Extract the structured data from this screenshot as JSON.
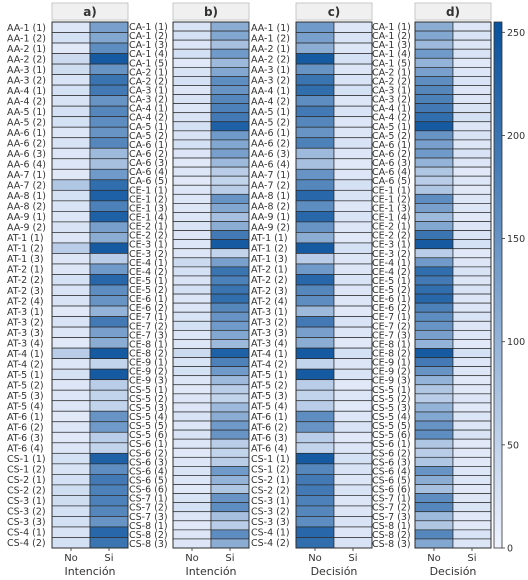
{
  "chart_data": {
    "type": "heatmap",
    "colorbar": {
      "ticks": [
        "0",
        "50",
        "100",
        "150",
        "200",
        "250"
      ],
      "tick_values": [
        0,
        50,
        100,
        150,
        200,
        250
      ],
      "range": [
        0,
        255
      ],
      "colors": [
        "#eff3ff",
        "#08519c"
      ]
    },
    "panels": [
      {
        "title": "a)",
        "xlabel": "Intención",
        "columns": [
          "No",
          "Si"
        ],
        "rows": [
          "AA-1 (1)",
          "AA-1 (2)",
          "AA-2 (1)",
          "AA-2 (2)",
          "AA-3 (1)",
          "AA-3 (2)",
          "AA-4 (1)",
          "AA-4 (2)",
          "AA-5 (1)",
          "AA-5 (2)",
          "AA-6 (1)",
          "AA-6 (2)",
          "AA-6 (3)",
          "AA-6 (4)",
          "AA-7 (1)",
          "AA-7 (2)",
          "AA-8 (1)",
          "AA-8 (2)",
          "AA-9 (1)",
          "AA-9 (2)",
          "AT-1 (1)",
          "AT-1 (2)",
          "AT-1 (3)",
          "AT-2 (1)",
          "AT-2 (2)",
          "AT-2 (3)",
          "AT-2 (4)",
          "AT-3 (1)",
          "AT-3 (2)",
          "AT-3 (3)",
          "AT-3 (4)",
          "AT-4 (1)",
          "AT-4 (2)",
          "AT-5 (1)",
          "AT-5 (2)",
          "AT-5 (3)",
          "AT-5 (4)",
          "AT-6 (1)",
          "AT-6 (2)",
          "AT-6 (3)",
          "AT-6 (4)",
          "CS-1 (1)",
          "CS-1 (2)",
          "CS-2 (1)",
          "CS-2 (2)",
          "CS-3 (1)",
          "CS-3 (2)",
          "CS-3 (3)",
          "CS-4 (1)",
          "CS-4 (2)"
        ],
        "values": [
          [
            20,
            130
          ],
          [
            30,
            120
          ],
          [
            15,
            160
          ],
          [
            40,
            240
          ],
          [
            35,
            150
          ],
          [
            25,
            200
          ],
          [
            30,
            190
          ],
          [
            25,
            150
          ],
          [
            30,
            170
          ],
          [
            30,
            160
          ],
          [
            20,
            150
          ],
          [
            25,
            170
          ],
          [
            20,
            90
          ],
          [
            20,
            80
          ],
          [
            15,
            140
          ],
          [
            70,
            210
          ],
          [
            30,
            230
          ],
          [
            25,
            180
          ],
          [
            20,
            230
          ],
          [
            25,
            130
          ],
          [
            20,
            110
          ],
          [
            60,
            240
          ],
          [
            20,
            60
          ],
          [
            20,
            140
          ],
          [
            30,
            220
          ],
          [
            25,
            160
          ],
          [
            25,
            150
          ],
          [
            15,
            100
          ],
          [
            25,
            190
          ],
          [
            20,
            130
          ],
          [
            15,
            110
          ],
          [
            60,
            240
          ],
          [
            20,
            50
          ],
          [
            30,
            240
          ],
          [
            20,
            60
          ],
          [
            20,
            50
          ],
          [
            20,
            50
          ],
          [
            15,
            150
          ],
          [
            20,
            140
          ],
          [
            15,
            60
          ],
          [
            20,
            50
          ],
          [
            30,
            230
          ],
          [
            25,
            160
          ],
          [
            30,
            190
          ],
          [
            35,
            180
          ],
          [
            35,
            180
          ],
          [
            30,
            170
          ],
          [
            30,
            150
          ],
          [
            25,
            220
          ],
          [
            30,
            200
          ]
        ]
      },
      {
        "title": "b)",
        "xlabel": "Intención",
        "columns": [
          "No",
          "Si"
        ],
        "rows": [
          "CA-1 (1)",
          "CA-1 (2)",
          "CA-1 (3)",
          "CA-1 (4)",
          "CA-1 (5)",
          "CA-2 (1)",
          "CA-2 (2)",
          "CA-3 (1)",
          "CA-3 (2)",
          "CA-4 (1)",
          "CA-4 (2)",
          "CA-5 (1)",
          "CA-5 (2)",
          "CA-6 (1)",
          "CA-6 (2)",
          "CA-6 (3)",
          "CA-6 (4)",
          "CA-6 (5)",
          "CE-1 (1)",
          "CE-1 (2)",
          "CE-1 (3)",
          "CE-1 (4)",
          "CE-2 (1)",
          "CE-2 (2)",
          "CE-3 (1)",
          "CE-3 (2)",
          "CE-4 (1)",
          "CE-4 (2)",
          "CE-5 (1)",
          "CE-5 (2)",
          "CE-6 (1)",
          "CE-6 (2)",
          "CE-7 (1)",
          "CE-7 (2)",
          "CE-7 (3)",
          "CE-8 (1)",
          "CE-8 (2)",
          "CE-9 (1)",
          "CE-9 (2)",
          "CE-9 (3)",
          "CS-5 (1)",
          "CS-5 (2)",
          "CS-5 (3)",
          "CS-5 (4)",
          "CS-5 (5)",
          "CS-5 (6)",
          "CS-6 (1)",
          "CS-6 (2)",
          "CS-6 (3)",
          "CS-6 (4)",
          "CS-6 (5)",
          "CS-6 (6)",
          "CS-7 (1)",
          "CS-7 (2)",
          "CS-7 (3)",
          "CS-8 (1)",
          "CS-8 (2)",
          "CS-8 (3)"
        ],
        "values": [
          [
            25,
            110
          ],
          [
            30,
            120
          ],
          [
            20,
            80
          ],
          [
            30,
            140
          ],
          [
            15,
            90
          ],
          [
            25,
            120
          ],
          [
            30,
            160
          ],
          [
            20,
            150
          ],
          [
            25,
            170
          ],
          [
            20,
            180
          ],
          [
            25,
            190
          ],
          [
            30,
            230
          ],
          [
            25,
            140
          ],
          [
            30,
            120
          ],
          [
            20,
            130
          ],
          [
            15,
            90
          ],
          [
            20,
            60
          ],
          [
            15,
            50
          ],
          [
            20,
            60
          ],
          [
            20,
            150
          ],
          [
            20,
            120
          ],
          [
            20,
            80
          ],
          [
            25,
            110
          ],
          [
            20,
            190
          ],
          [
            20,
            240
          ],
          [
            20,
            50
          ],
          [
            40,
            130
          ],
          [
            30,
            200
          ],
          [
            25,
            180
          ],
          [
            30,
            200
          ],
          [
            20,
            210
          ],
          [
            20,
            170
          ],
          [
            25,
            150
          ],
          [
            30,
            140
          ],
          [
            20,
            120
          ],
          [
            20,
            90
          ],
          [
            40,
            230
          ],
          [
            25,
            180
          ],
          [
            30,
            140
          ],
          [
            20,
            90
          ],
          [
            15,
            60
          ],
          [
            20,
            50
          ],
          [
            20,
            90
          ],
          [
            25,
            110
          ],
          [
            20,
            140
          ],
          [
            25,
            150
          ],
          [
            20,
            60
          ],
          [
            15,
            50
          ],
          [
            20,
            60
          ],
          [
            25,
            140
          ],
          [
            20,
            100
          ],
          [
            15,
            70
          ],
          [
            25,
            150
          ],
          [
            30,
            160
          ],
          [
            20,
            80
          ],
          [
            15,
            60
          ],
          [
            20,
            160
          ],
          [
            20,
            110
          ]
        ]
      },
      {
        "title": "c)",
        "xlabel": "Decisión",
        "columns": [
          "No",
          "Si"
        ],
        "rows": [
          "AA-1 (1)",
          "AA-1 (2)",
          "AA-2 (1)",
          "AA-2 (2)",
          "AA-3 (1)",
          "AA-3 (2)",
          "AA-4 (1)",
          "AA-4 (2)",
          "AA-5 (1)",
          "AA-5 (2)",
          "AA-6 (1)",
          "AA-6 (2)",
          "AA-6 (3)",
          "AA-6 (4)",
          "AA-7 (1)",
          "AA-7 (2)",
          "AA-8 (1)",
          "AA-8 (2)",
          "AA-9 (1)",
          "AA-9 (2)",
          "AT-1 (1)",
          "AT-1 (2)",
          "AT-1 (3)",
          "AT-2 (1)",
          "AT-2 (2)",
          "AT-2 (3)",
          "AT-2 (4)",
          "AT-3 (1)",
          "AT-3 (2)",
          "AT-3 (3)",
          "AT-3 (4)",
          "AT-4 (1)",
          "AT-4 (2)",
          "AT-5 (1)",
          "AT-5 (2)",
          "AT-5 (3)",
          "AT-5 (4)",
          "AT-6 (1)",
          "AT-6 (2)",
          "AT-6 (3)",
          "AT-6 (4)",
          "CS-1 (1)",
          "CS-1 (2)",
          "CS-2 (1)",
          "CS-2 (2)",
          "CS-3 (1)",
          "CS-3 (2)",
          "CS-3 (3)",
          "CS-4 (1)",
          "CS-4 (2)"
        ],
        "values": [
          [
            140,
            20
          ],
          [
            130,
            25
          ],
          [
            110,
            20
          ],
          [
            240,
            30
          ],
          [
            150,
            20
          ],
          [
            200,
            25
          ],
          [
            210,
            30
          ],
          [
            160,
            20
          ],
          [
            190,
            25
          ],
          [
            170,
            20
          ],
          [
            150,
            20
          ],
          [
            180,
            25
          ],
          [
            90,
            20
          ],
          [
            80,
            15
          ],
          [
            150,
            20
          ],
          [
            170,
            30
          ],
          [
            220,
            25
          ],
          [
            160,
            20
          ],
          [
            220,
            25
          ],
          [
            150,
            20
          ],
          [
            110,
            15
          ],
          [
            240,
            30
          ],
          [
            60,
            20
          ],
          [
            140,
            20
          ],
          [
            220,
            25
          ],
          [
            170,
            20
          ],
          [
            160,
            20
          ],
          [
            90,
            15
          ],
          [
            190,
            25
          ],
          [
            130,
            20
          ],
          [
            110,
            15
          ],
          [
            240,
            30
          ],
          [
            50,
            20
          ],
          [
            240,
            25
          ],
          [
            60,
            15
          ],
          [
            50,
            20
          ],
          [
            60,
            15
          ],
          [
            160,
            20
          ],
          [
            150,
            25
          ],
          [
            60,
            15
          ],
          [
            50,
            20
          ],
          [
            240,
            30
          ],
          [
            170,
            25
          ],
          [
            190,
            20
          ],
          [
            190,
            25
          ],
          [
            180,
            20
          ],
          [
            170,
            20
          ],
          [
            160,
            25
          ],
          [
            220,
            20
          ],
          [
            210,
            25
          ]
        ]
      },
      {
        "title": "d)",
        "xlabel": "Decisión",
        "columns": [
          "No",
          "Si"
        ],
        "rows": [
          "CA-1 (1)",
          "CA-1 (2)",
          "CA-1 (3)",
          "CA-1 (4)",
          "CA-1 (5)",
          "CA-2 (1)",
          "CA-2 (2)",
          "CA-3 (1)",
          "CA-3 (2)",
          "CA-4 (1)",
          "CA-4 (2)",
          "CA-5 (1)",
          "CA-5 (2)",
          "CA-6 (1)",
          "CA-6 (2)",
          "CA-6 (3)",
          "CA-6 (4)",
          "CA-6 (5)",
          "CE-1 (1)",
          "CE-1 (2)",
          "CE-1 (3)",
          "CE-1 (4)",
          "CE-2 (1)",
          "CE-2 (2)",
          "CE-3 (1)",
          "CE-3 (2)",
          "CE-4 (1)",
          "CE-4 (2)",
          "CE-5 (1)",
          "CE-5 (2)",
          "CE-6 (1)",
          "CE-6 (2)",
          "CE-7 (1)",
          "CE-7 (2)",
          "CE-7 (3)",
          "CE-8 (1)",
          "CE-8 (2)",
          "CE-9 (1)",
          "CE-9 (2)",
          "CE-9 (3)",
          "CS-5 (1)",
          "CS-5 (2)",
          "CS-5 (3)",
          "CS-5 (4)",
          "CS-5 (5)",
          "CS-5 (6)",
          "CS-6 (1)",
          "CS-6 (2)",
          "CS-6 (3)",
          "CS-6 (4)",
          "CS-6 (5)",
          "CS-6 (6)",
          "CS-7 (1)",
          "CS-7 (2)",
          "CS-7 (3)",
          "CS-8 (1)",
          "CS-8 (2)",
          "CS-8 (3)"
        ],
        "values": [
          [
            110,
            20
          ],
          [
            120,
            25
          ],
          [
            90,
            20
          ],
          [
            140,
            25
          ],
          [
            100,
            15
          ],
          [
            130,
            20
          ],
          [
            160,
            25
          ],
          [
            170,
            20
          ],
          [
            180,
            20
          ],
          [
            190,
            25
          ],
          [
            210,
            30
          ],
          [
            240,
            20
          ],
          [
            150,
            25
          ],
          [
            130,
            20
          ],
          [
            140,
            25
          ],
          [
            100,
            20
          ],
          [
            70,
            15
          ],
          [
            60,
            20
          ],
          [
            70,
            15
          ],
          [
            160,
            20
          ],
          [
            130,
            20
          ],
          [
            90,
            15
          ],
          [
            120,
            20
          ],
          [
            200,
            25
          ],
          [
            240,
            30
          ],
          [
            60,
            15
          ],
          [
            140,
            20
          ],
          [
            210,
            25
          ],
          [
            190,
            20
          ],
          [
            210,
            25
          ],
          [
            220,
            20
          ],
          [
            180,
            20
          ],
          [
            160,
            25
          ],
          [
            150,
            20
          ],
          [
            130,
            20
          ],
          [
            100,
            15
          ],
          [
            240,
            30
          ],
          [
            190,
            20
          ],
          [
            150,
            20
          ],
          [
            100,
            15
          ],
          [
            70,
            15
          ],
          [
            60,
            20
          ],
          [
            100,
            15
          ],
          [
            120,
            20
          ],
          [
            150,
            20
          ],
          [
            160,
            25
          ],
          [
            70,
            15
          ],
          [
            60,
            15
          ],
          [
            70,
            15
          ],
          [
            150,
            20
          ],
          [
            110,
            20
          ],
          [
            80,
            15
          ],
          [
            160,
            20
          ],
          [
            170,
            25
          ],
          [
            90,
            15
          ],
          [
            70,
            15
          ],
          [
            170,
            25
          ],
          [
            120,
            20
          ]
        ]
      }
    ]
  }
}
